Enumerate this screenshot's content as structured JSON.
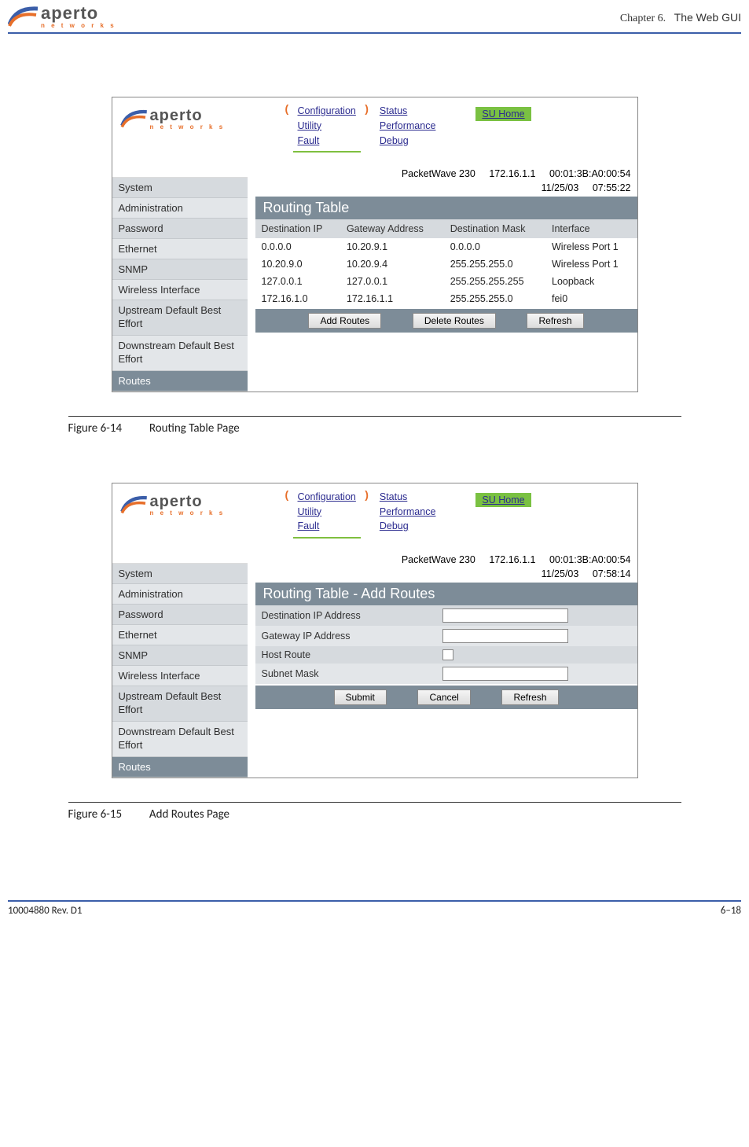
{
  "doc": {
    "chapter_prefix": "Chapter 6.",
    "chapter_title": "The Web GUI",
    "footer_left": "10004880 Rev. D1",
    "footer_right": "6–18",
    "logo_text": "aperto",
    "logo_sub": "n e t w o r k s"
  },
  "nav": {
    "col1": [
      "Configuration",
      "Utility",
      "Fault"
    ],
    "col2": [
      "Status",
      "Performance",
      "Debug"
    ],
    "su_home": "SU Home"
  },
  "device": {
    "model": "PacketWave 230",
    "ip": "172.16.1.1",
    "mac": "00:01:3B:A0:00:54"
  },
  "sidebar_items": [
    "System",
    "Administration",
    "Password",
    "Ethernet",
    "SNMP",
    "Wireless Interface",
    "Upstream Default Best Effort",
    "Downstream Default Best Effort",
    "Routes"
  ],
  "fig1": {
    "time": {
      "date": "11/25/03",
      "clock": "07:55:22"
    },
    "panel_title": "Routing Table",
    "headers": [
      "Destination IP",
      "Gateway Address",
      "Destination Mask",
      "Interface"
    ],
    "rows": [
      [
        "0.0.0.0",
        "10.20.9.1",
        "0.0.0.0",
        "Wireless Port 1"
      ],
      [
        "10.20.9.0",
        "10.20.9.4",
        "255.255.255.0",
        "Wireless Port 1"
      ],
      [
        "127.0.0.1",
        "127.0.0.1",
        "255.255.255.255",
        "Loopback"
      ],
      [
        "172.16.1.0",
        "172.16.1.1",
        "255.255.255.0",
        "fei0"
      ]
    ],
    "buttons": [
      "Add Routes",
      "Delete Routes",
      "Refresh"
    ],
    "caption_num": "Figure 6-14",
    "caption_text": "Routing Table Page"
  },
  "fig2": {
    "time": {
      "date": "11/25/03",
      "clock": "07:58:14"
    },
    "panel_title": "Routing Table - Add Routes",
    "fields": [
      {
        "label": "Destination IP Address",
        "type": "text"
      },
      {
        "label": "Gateway IP Address",
        "type": "text"
      },
      {
        "label": "Host Route",
        "type": "checkbox"
      },
      {
        "label": "Subnet Mask",
        "type": "text"
      }
    ],
    "buttons": [
      "Submit",
      "Cancel",
      "Refresh"
    ],
    "caption_num": "Figure 6-15",
    "caption_text": "Add Routes Page"
  }
}
